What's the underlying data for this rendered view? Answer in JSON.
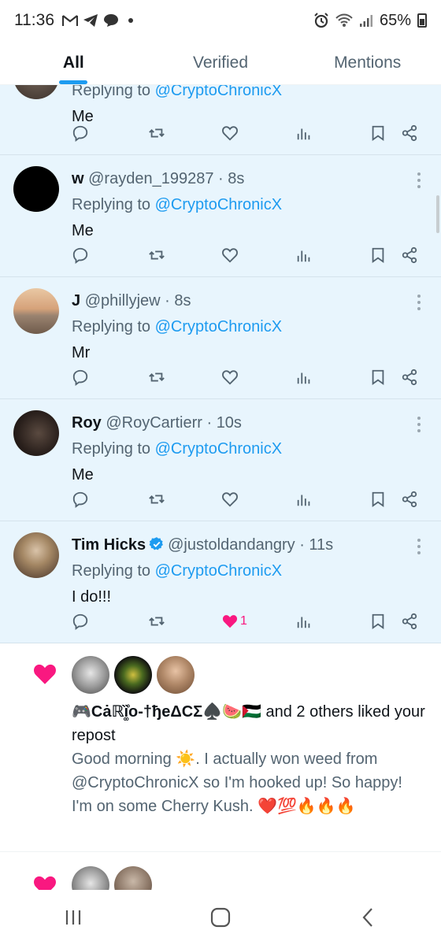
{
  "status_bar": {
    "time": "11:36",
    "battery": "65%",
    "left_icons": [
      "gmail-icon",
      "telegram-icon",
      "chat-bubble-icon",
      "dot-icon"
    ],
    "right_icons": [
      "alarm-icon",
      "wifi-icon",
      "signal-icon",
      "battery-icon"
    ]
  },
  "tabs": [
    {
      "label": "All",
      "active": true
    },
    {
      "label": "Verified",
      "active": false
    },
    {
      "label": "Mentions",
      "active": false
    }
  ],
  "replies": [
    {
      "name": "",
      "handle": "",
      "time": "",
      "replying_prefix": "Replying to",
      "replying_to": "@CryptoChronicX",
      "text": "Me",
      "likes": ""
    },
    {
      "name": "w",
      "handle": "@rayden_199287",
      "time": "8s",
      "replying_prefix": "Replying to",
      "replying_to": "@CryptoChronicX",
      "text": "Me",
      "likes": ""
    },
    {
      "name": "J",
      "handle": "@phillyjew",
      "time": "8s",
      "replying_prefix": "Replying to",
      "replying_to": "@CryptoChronicX",
      "text": "Mr",
      "likes": ""
    },
    {
      "name": "Roy",
      "handle": "@RoyCartierr",
      "time": "10s",
      "replying_prefix": "Replying to",
      "replying_to": "@CryptoChronicX",
      "text": "Me",
      "likes": ""
    },
    {
      "name": "Tim Hicks",
      "handle": "@justoldandangry",
      "time": "11s",
      "replying_prefix": "Replying to",
      "replying_to": "@CryptoChronicX",
      "text": "I do!!!",
      "likes": "1"
    }
  ],
  "notification": {
    "who_name": "🎮Cȧℝȉ͚̊o-†ђeΔCΣ♠️🍉🇵🇸",
    "who_suffix": " and 2 others liked your repost",
    "text": "Good morning ☀️.  I actually won weed from @CryptoChronicX  so I'm hooked up!  So happy!   I'm on some Cherry Kush.  ❤️💯🔥🔥🔥"
  },
  "colors": {
    "accent": "#1d9bf0",
    "like": "#f91880",
    "reply_bg": "#e8f5fd",
    "secondary_text": "#536471"
  }
}
